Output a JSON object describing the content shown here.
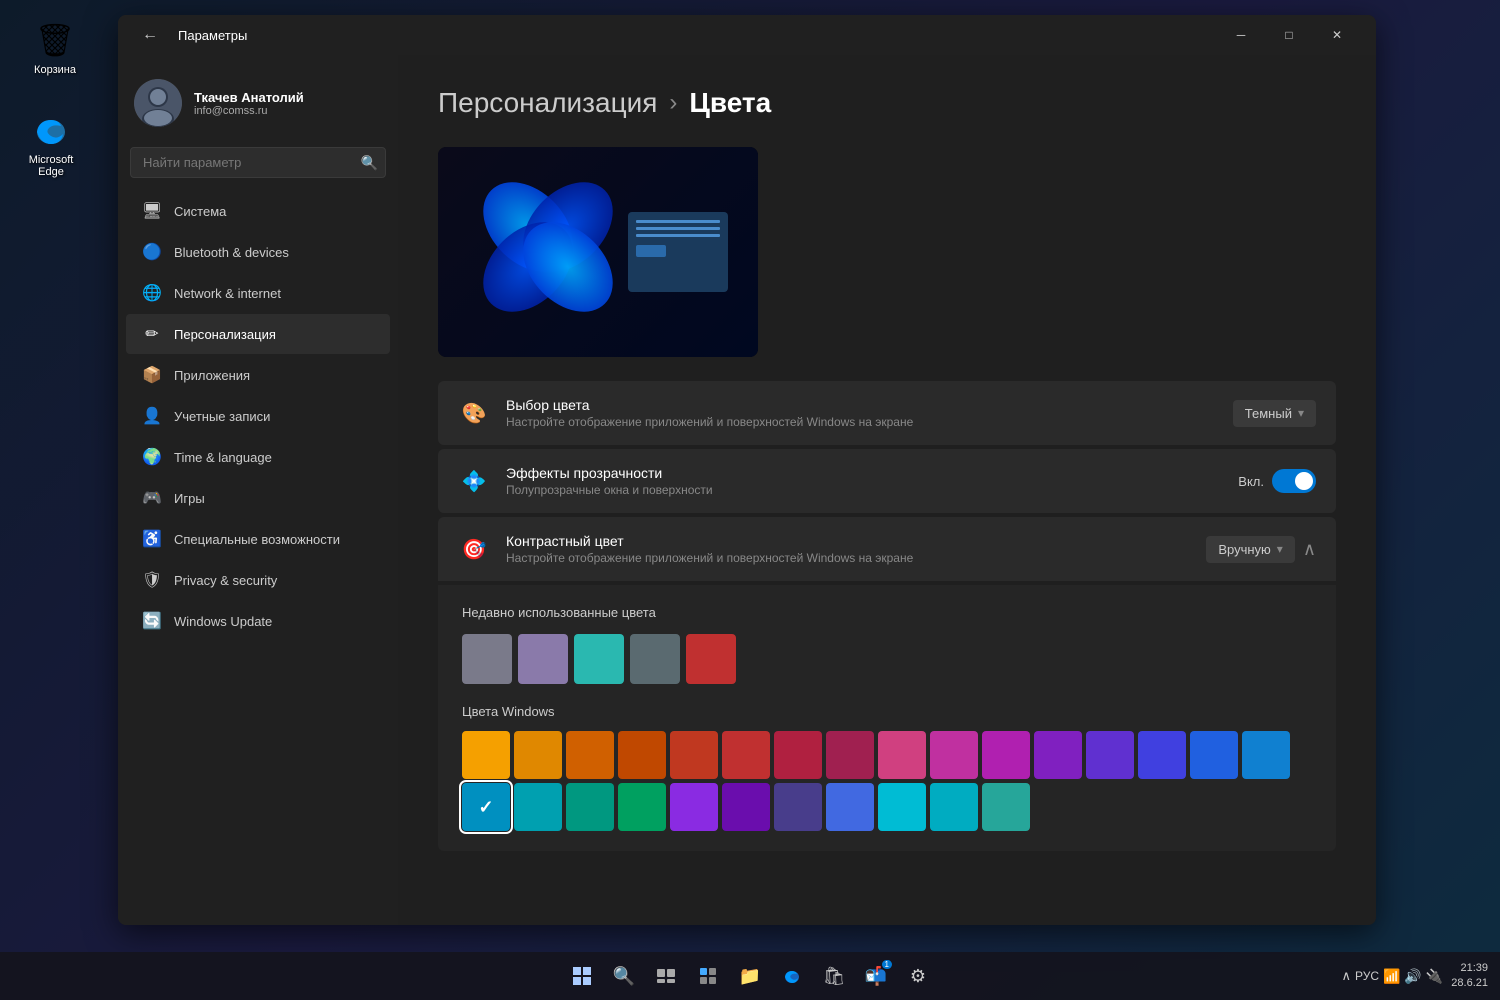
{
  "desktop": {
    "icons": [
      {
        "id": "recycle-bin",
        "label": "Корзина",
        "symbol": "🗑"
      }
    ],
    "edge_icon_label": "Microsoft Edge"
  },
  "taskbar": {
    "clock": "21:39",
    "date": "28.6.21",
    "lang": "РУС"
  },
  "window": {
    "title": "Параметры",
    "back_button": "←"
  },
  "user": {
    "name": "Ткачев Анатолий",
    "email": "info@comss.ru"
  },
  "search": {
    "placeholder": "Найти параметр"
  },
  "nav": [
    {
      "id": "system",
      "label": "Система",
      "icon": "🖥"
    },
    {
      "id": "bluetooth",
      "label": "Bluetooth & devices",
      "icon": "🔵"
    },
    {
      "id": "network",
      "label": "Network & internet",
      "icon": "🌐"
    },
    {
      "id": "personalization",
      "label": "Персонализация",
      "icon": "✏"
    },
    {
      "id": "apps",
      "label": "Приложения",
      "icon": "📦"
    },
    {
      "id": "accounts",
      "label": "Учетные записи",
      "icon": "👤"
    },
    {
      "id": "time",
      "label": "Time & language",
      "icon": "🌍"
    },
    {
      "id": "gaming",
      "label": "Игры",
      "icon": "🎮"
    },
    {
      "id": "accessibility",
      "label": "Специальные возможности",
      "icon": "♿"
    },
    {
      "id": "privacy",
      "label": "Privacy & security",
      "icon": "🛡"
    },
    {
      "id": "update",
      "label": "Windows Update",
      "icon": "🔄"
    }
  ],
  "breadcrumb": {
    "parent": "Персонализация",
    "separator": "›",
    "current": "Цвета"
  },
  "settings": [
    {
      "id": "color-choice",
      "icon": "🎨",
      "title": "Выбор цвета",
      "desc": "Настройте отображение приложений и поверхностей Windows на экране",
      "control_type": "dropdown",
      "control_label": "Темный"
    },
    {
      "id": "transparency",
      "icon": "💠",
      "title": "Эффекты прозрачности",
      "desc": "Полупрозрачные окна и поверхности",
      "control_type": "toggle",
      "toggle_label": "Вкл.",
      "toggle_on": true
    },
    {
      "id": "accent-color",
      "icon": "🎯",
      "title": "Контрастный цвет",
      "desc": "Настройте отображение приложений и поверхностей Windows на экране",
      "control_type": "dropdown-expand",
      "control_label": "Вручную",
      "expanded": true
    }
  ],
  "expanded": {
    "recent_label": "Недавно использованные цвета",
    "recent_colors": [
      "#7a7a8a",
      "#8a7aaa",
      "#2ab8b0",
      "#5a6a70",
      "#c03030"
    ],
    "windows_label": "Цвета Windows",
    "color_grid": [
      "#f5a000",
      "#e08800",
      "#d06000",
      "#c04800",
      "#c03820",
      "#c03030",
      "#b02040",
      "#a02050",
      "#d04080",
      "#c030a0",
      "#b020b0",
      "#8020c0",
      "#6030d0",
      "#4040e0",
      "#2060e0",
      "#1080d0",
      "#0090c0",
      "#00a0b0",
      "#009880",
      "#00a060"
    ],
    "selected_color": "#0078d4"
  }
}
